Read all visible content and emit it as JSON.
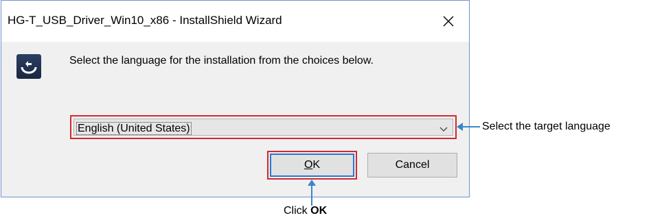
{
  "window": {
    "title": "HG-T_USB_Driver_Win10_x86 - InstallShield Wizard",
    "close_glyph": "✕",
    "app_icon": "installshield-icon"
  },
  "dialog": {
    "message": "Select the language for the installation from the choices below.",
    "language_select": {
      "value": "English (United States)",
      "icon": "chevron-down-icon"
    },
    "ok_label": "OK",
    "cancel_label": "Cancel"
  },
  "annotations": {
    "language_callout": "Select the target language",
    "ok_callout_prefix": "Click",
    "ok_callout_bold": "OK",
    "arrow_color": "#3a86c8",
    "highlight_color": "#d2282e"
  }
}
